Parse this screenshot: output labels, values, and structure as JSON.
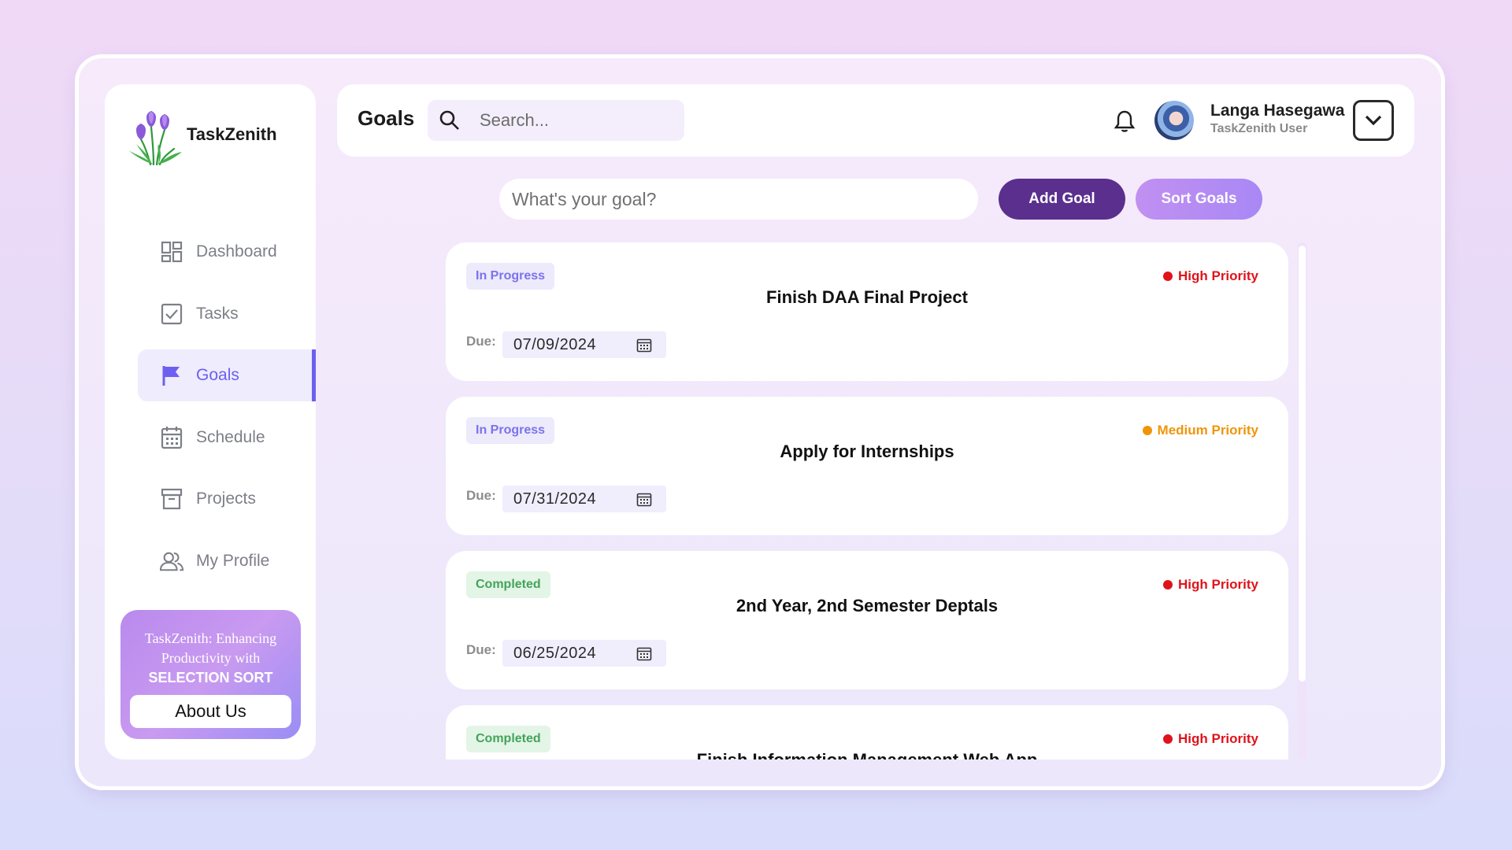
{
  "brand": {
    "name": "TaskZenith"
  },
  "sidebar": {
    "items": [
      {
        "label": "Dashboard",
        "icon": "dashboard-icon"
      },
      {
        "label": "Tasks",
        "icon": "checkbox-icon"
      },
      {
        "label": "Goals",
        "icon": "flag-icon",
        "active": true
      },
      {
        "label": "Schedule",
        "icon": "calendar-icon"
      },
      {
        "label": "Projects",
        "icon": "archive-icon"
      },
      {
        "label": "My Profile",
        "icon": "users-icon"
      }
    ],
    "promo": {
      "line1": "TaskZenith: Enhancing",
      "line2": "Productivity with",
      "line3": "SELECTION SORT",
      "button": "About Us"
    }
  },
  "header": {
    "title": "Goals",
    "search_placeholder": "Search...",
    "user_name": "Langa Hasegawa",
    "user_role": "TaskZenith User"
  },
  "goal_form": {
    "placeholder": "What's your goal?",
    "add_label": "Add Goal",
    "sort_label": "Sort Goals"
  },
  "goals": [
    {
      "status": "In Progress",
      "priority": "High Priority",
      "title": "Finish DAA Final Project",
      "due_label": "Due:",
      "due": "07/09/2024"
    },
    {
      "status": "In Progress",
      "priority": "Medium Priority",
      "title": "Apply for Internships",
      "due_label": "Due:",
      "due": "07/31/2024"
    },
    {
      "status": "Completed",
      "priority": "High Priority",
      "title": "2nd Year, 2nd Semester Deptals",
      "due_label": "Due:",
      "due": "06/25/2024"
    },
    {
      "status": "Completed",
      "priority": "High Priority",
      "title": "Finish Information Management Web App",
      "due_label": "Due:",
      "due": ""
    }
  ],
  "colors": {
    "accent": "#6d5ff0",
    "add_button": "#5b2f8e",
    "high_priority": "#e0131a",
    "medium_priority": "#f0950a",
    "completed": "#44a35a"
  }
}
